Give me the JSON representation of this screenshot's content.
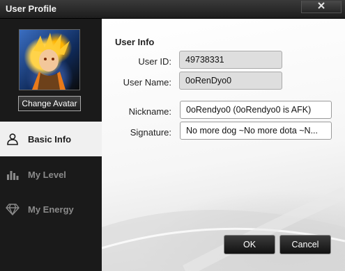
{
  "window": {
    "title": "User Profile"
  },
  "icons": {
    "close": "close-icon",
    "basic_info": "person-icon",
    "my_level": "bar-chart-icon",
    "my_energy": "diamond-icon"
  },
  "sidebar": {
    "change_avatar_label": "Change Avatar",
    "items": [
      {
        "label": "Basic Info",
        "active": true
      },
      {
        "label": "My Level",
        "active": false
      },
      {
        "label": "My Energy",
        "active": false
      }
    ]
  },
  "user_info": {
    "section_title": "User Info",
    "user_id_label": "User ID:",
    "user_id": "49738331",
    "user_name_label": "User Name:",
    "user_name": "0oRenDyo0",
    "nickname_label": "Nickname:",
    "nickname": "0oRendyo0 (0oRendyo0 is AFK)",
    "signature_label": "Signature:",
    "signature": "No more dog ~No more dota ~N..."
  },
  "buttons": {
    "ok": "OK",
    "cancel": "Cancel"
  },
  "colors": {
    "active_nav_bg": "#f0f0f0",
    "sidebar_bg": "#1a1a1a",
    "titlebar": "#2b2b2b"
  }
}
